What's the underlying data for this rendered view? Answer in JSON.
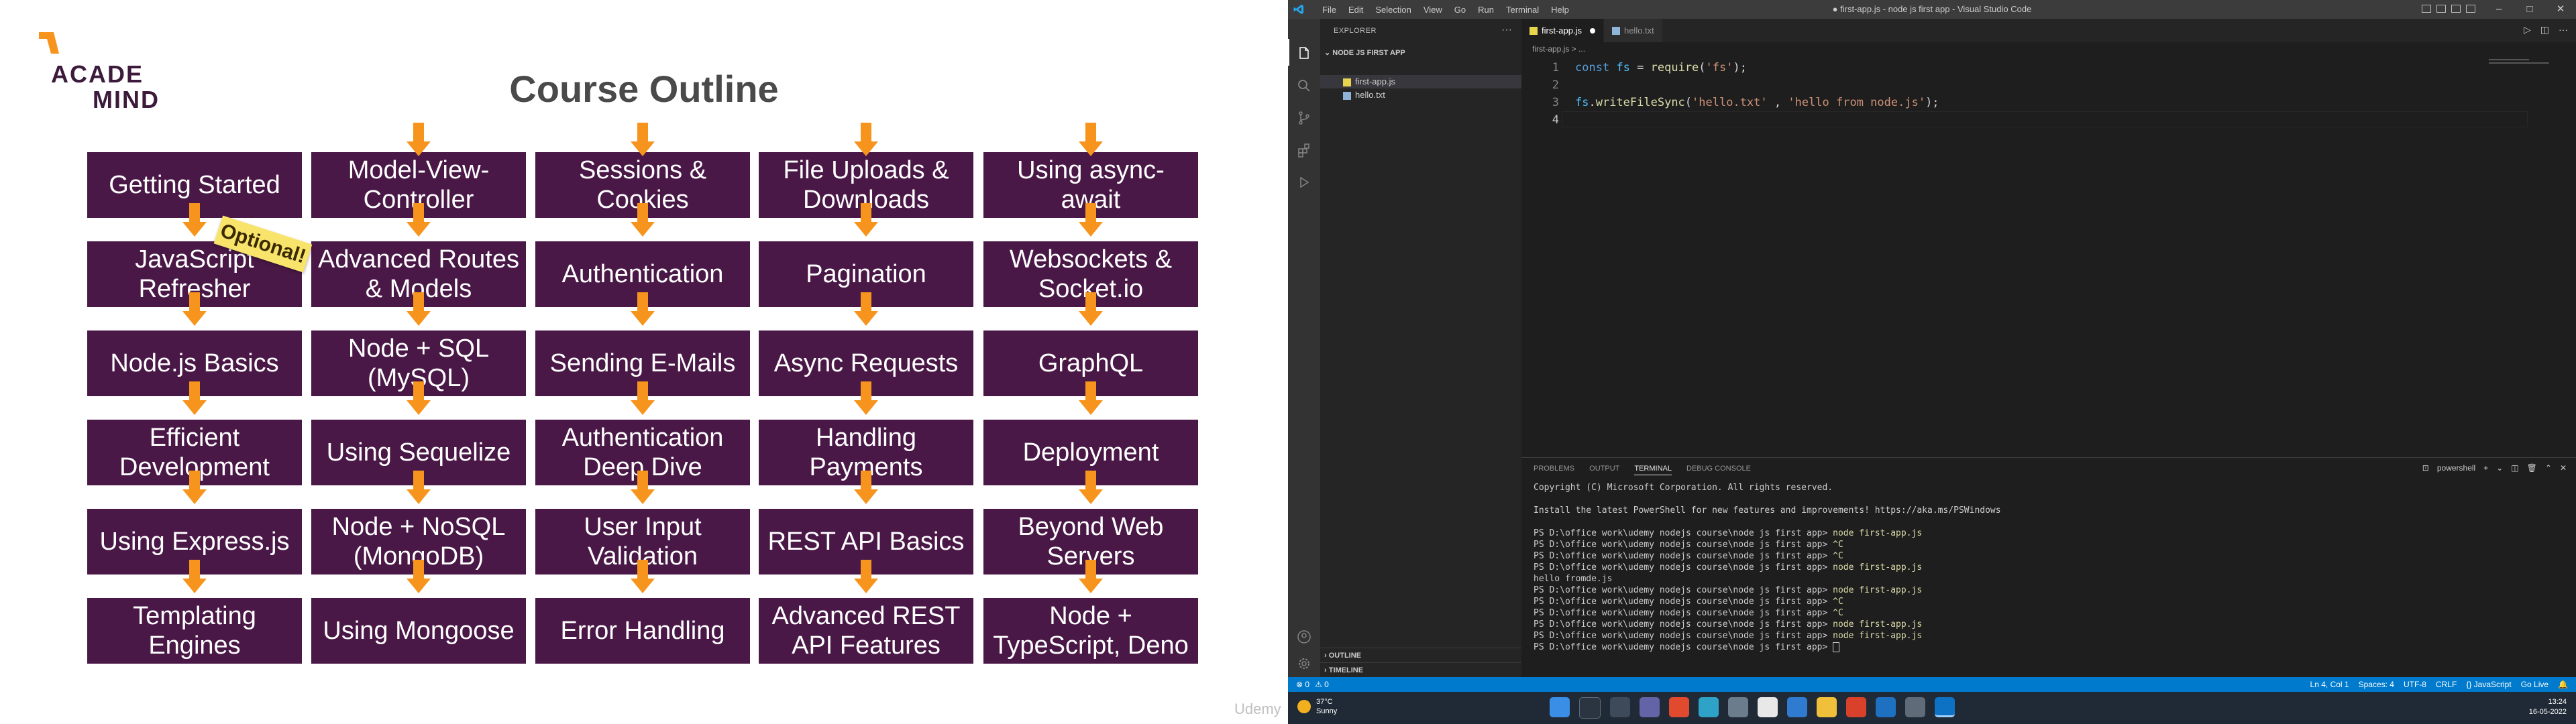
{
  "slide": {
    "logo_line1": "ACADE",
    "logo_line2": "MIND",
    "title": "Course Outline",
    "optional_tag": "Optional!",
    "watermark": "Udemy",
    "columns": [
      [
        "Getting Started",
        "JavaScript Refresher",
        "Node.js Basics",
        "Efficient Development",
        "Using Express.js",
        "Templating Engines"
      ],
      [
        "Model-View-Controller",
        "Advanced Routes & Models",
        "Node + SQL (MySQL)",
        "Using Sequelize",
        "Node + NoSQL (MongoDB)",
        "Using Mongoose"
      ],
      [
        "Sessions & Cookies",
        "Authentication",
        "Sending E-Mails",
        "Authentication Deep Dive",
        "User Input Validation",
        "Error Handling"
      ],
      [
        "File Uploads & Downloads",
        "Pagination",
        "Async Requests",
        "Handling Payments",
        "REST API Basics",
        "Advanced REST API Features"
      ],
      [
        "Using async-await",
        "Websockets & Socket.io",
        "GraphQL",
        "Deployment",
        "Beyond Web Servers",
        "Node + TypeScript, Deno"
      ]
    ],
    "colors": {
      "box": "#4a1847",
      "arrow": "#f7941d",
      "tag": "#f8e36b"
    }
  },
  "vscode": {
    "menu": [
      "File",
      "Edit",
      "Selection",
      "View",
      "Go",
      "Run",
      "Terminal",
      "Help"
    ],
    "window_title": "● first-app.js - node js first app - Visual Studio Code",
    "explorer_title": "EXPLORER",
    "project_name": "NODE JS FIRST APP",
    "files": [
      "first-app.js",
      "hello.txt"
    ],
    "outline_label": "OUTLINE",
    "timeline_label": "TIMELINE",
    "tabs": [
      "first-app.js",
      "hello.txt"
    ],
    "breadcrumb": "first-app.js > ...",
    "line_numbers": [
      "1",
      "2",
      "3",
      "4"
    ],
    "code": {
      "l1": {
        "kw": "const",
        "var": "fs",
        "eq": " = ",
        "fn": "require",
        "open": "(",
        "str": "'fs'",
        "close": ");"
      },
      "l3": {
        "var": "fs",
        "dot": ".",
        "fn": "writeFileSync",
        "open": "(",
        "str1": "'hello.txt'",
        "sep": " , ",
        "str2": "'hello from node.js'",
        "close": ");"
      }
    },
    "panel_tabs": [
      "PROBLEMS",
      "OUTPUT",
      "TERMINAL",
      "DEBUG CONSOLE"
    ],
    "terminal_shell": "powershell",
    "terminal": [
      {
        "prompt": "Copyright (C) Microsoft Corporation. All rights reserved.",
        "cmd": ""
      },
      {
        "prompt": "",
        "cmd": ""
      },
      {
        "prompt": "Install the latest PowerShell for new features and improvements! https://aka.ms/PSWindows",
        "cmd": ""
      },
      {
        "prompt": "",
        "cmd": ""
      },
      {
        "prompt": "PS D:\\office work\\udemy nodejs course\\node js first app> ",
        "cmd": "node first-app.js"
      },
      {
        "prompt": "PS D:\\office work\\udemy nodejs course\\node js first app> ",
        "cmd": "^C"
      },
      {
        "prompt": "PS D:\\office work\\udemy nodejs course\\node js first app> ",
        "cmd": "^C"
      },
      {
        "prompt": "PS D:\\office work\\udemy nodejs course\\node js first app> ",
        "cmd": "node first-app.js"
      },
      {
        "prompt": "hello fromde.js",
        "cmd": ""
      },
      {
        "prompt": "PS D:\\office work\\udemy nodejs course\\node js first app> ",
        "cmd": "node first-app.js"
      },
      {
        "prompt": "PS D:\\office work\\udemy nodejs course\\node js first app> ",
        "cmd": "^C"
      },
      {
        "prompt": "PS D:\\office work\\udemy nodejs course\\node js first app> ",
        "cmd": "^C"
      },
      {
        "prompt": "PS D:\\office work\\udemy nodejs course\\node js first app> ",
        "cmd": "node first-app.js"
      },
      {
        "prompt": "PS D:\\office work\\udemy nodejs course\\node js first app> ",
        "cmd": "node first-app.js"
      },
      {
        "prompt": "PS D:\\office work\\udemy nodejs course\\node js first app> ",
        "cmd": ""
      }
    ],
    "status_left": [
      "⊗ 0",
      "⚠ 0"
    ],
    "status_right": [
      "Ln 4, Col 1",
      "Spaces: 4",
      "UTF-8",
      "CRLF",
      "{} JavaScript",
      "Go Live"
    ],
    "colors": {
      "statusbar": "#007acc",
      "keyword": "#569cd6",
      "string": "#ce9178",
      "function": "#dcdcaa"
    }
  },
  "taskbar": {
    "temperature": "37°C",
    "weather": "Sunny",
    "time": "13:24",
    "date": "16-05-2022"
  }
}
